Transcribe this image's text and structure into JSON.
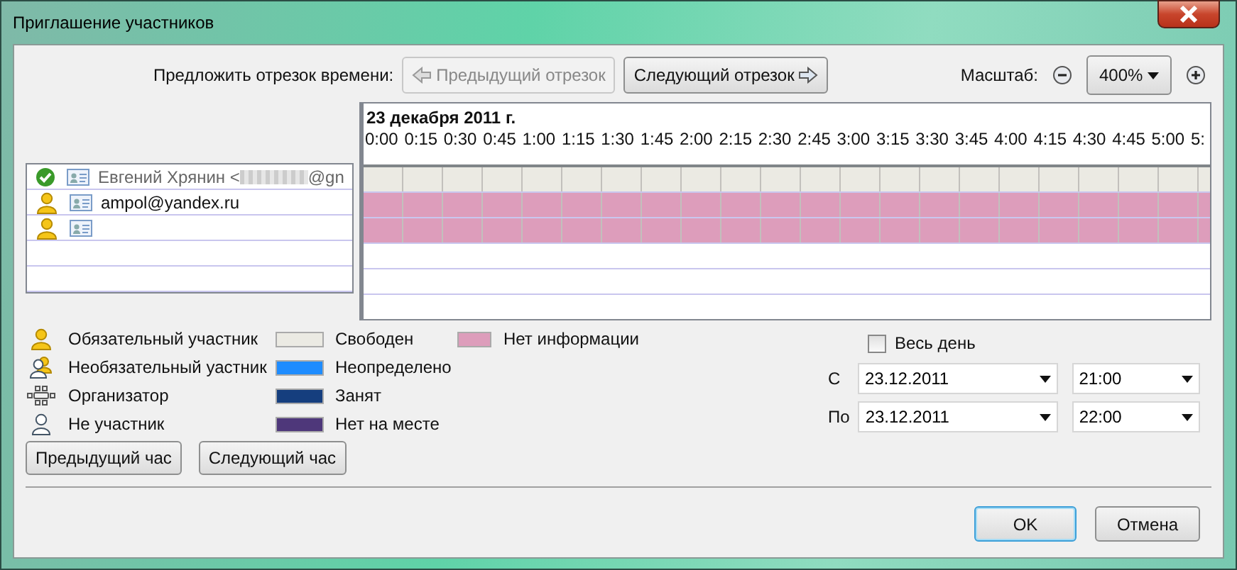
{
  "window": {
    "title": "Приглашение участников"
  },
  "toolbar": {
    "suggest_label": "Предложить отрезок времени:",
    "prev_button": {
      "label": "Предыдущий отрезок",
      "disabled": true
    },
    "next_button": {
      "label": "Следующий отрезок",
      "disabled": false
    },
    "zoom_label": "Масштаб:",
    "zoom_value": "400%"
  },
  "timeline": {
    "date": "23 декабря 2011 г.",
    "times": [
      "0:00",
      "0:15",
      "0:30",
      "0:45",
      "1:00",
      "1:15",
      "1:30",
      "1:45",
      "2:00",
      "2:15",
      "2:30",
      "2:45",
      "3:00",
      "3:15",
      "3:30",
      "3:45",
      "4:00",
      "4:15",
      "4:30",
      "4:45",
      "5:00",
      "5:"
    ]
  },
  "attendees": [
    {
      "kind": "accepted",
      "name": "Евгений Хрянин <",
      "name_tail": "@gn",
      "color": "#ebeae3"
    },
    {
      "kind": "required",
      "name": "ampol@yandex.ru",
      "color": "#dd9dbb"
    },
    {
      "kind": "required",
      "color": "#dd9dbb"
    }
  ],
  "legend_roles": [
    {
      "kind": "required",
      "label": "Обязательный участник"
    },
    {
      "kind": "optional",
      "label": "Необязательный уастник"
    },
    {
      "kind": "organizer",
      "label": "Организатор"
    },
    {
      "kind": "nonparticipant",
      "label": "Не участник"
    }
  ],
  "legend_statuses": [
    {
      "label": "Свободен",
      "color": "#ebeae3"
    },
    {
      "label": "Неопределено",
      "color": "#1e8cff"
    },
    {
      "label": "Занят",
      "color": "#153e7e"
    },
    {
      "label": "Нет на месте",
      "color": "#4e377a"
    },
    {
      "label": "Нет информации",
      "color": "#dd9dbb"
    }
  ],
  "hour_buttons": [
    "Предыдущий час",
    "Следующий час"
  ],
  "all_day": {
    "label": "Весь день",
    "checked": false
  },
  "start": {
    "label": "С",
    "date": "23.12.2011",
    "time": "21:00"
  },
  "end": {
    "label": "По",
    "date": "23.12.2011",
    "time": "22:00"
  },
  "buttons": [
    {
      "label": "OK",
      "default": true
    },
    {
      "label": "Отмена",
      "default": false
    }
  ]
}
